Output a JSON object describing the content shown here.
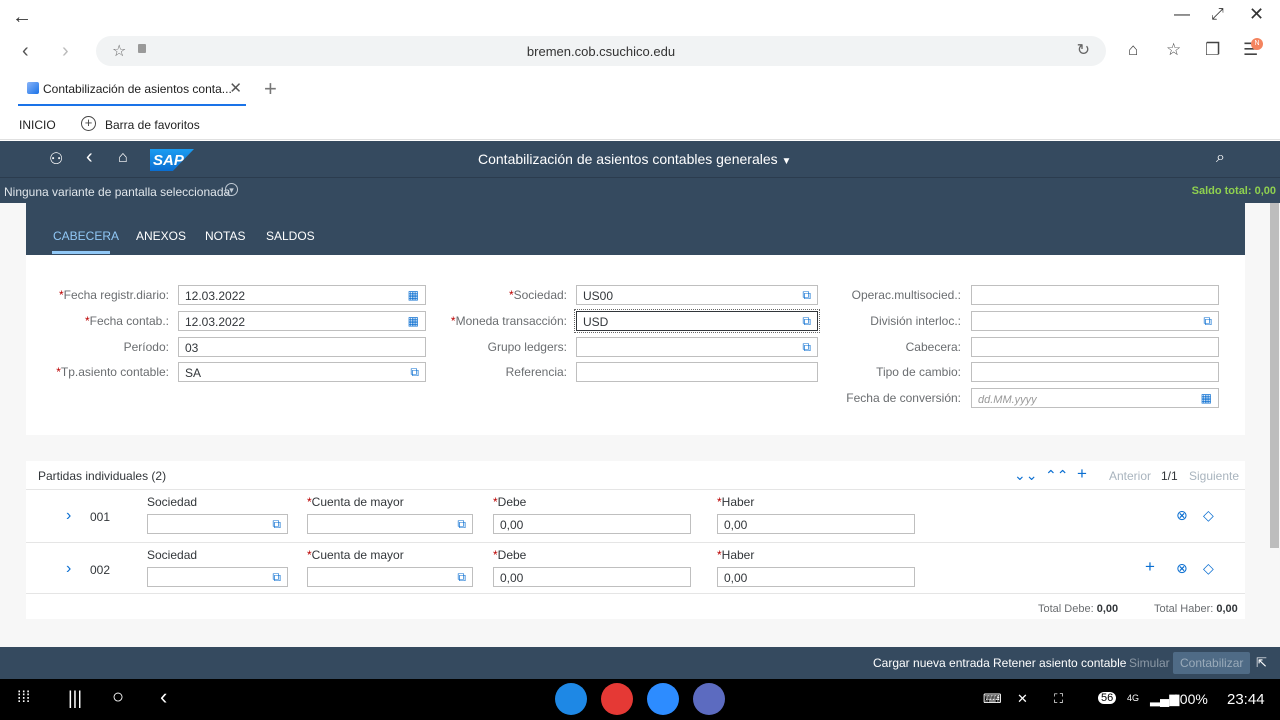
{
  "browser": {
    "url": "bremen.cob.csuchico.edu",
    "tab_title": "Contabilización de asientos conta...",
    "bookmarks": {
      "home": "INICIO",
      "favorites": "Barra de favoritos"
    },
    "profile_badge": "N"
  },
  "shell": {
    "app_title": "Contabilización de asientos contables generales",
    "logo_text": "SAP"
  },
  "subheader": {
    "variant": "Ninguna variante de pantalla seleccionada",
    "saldo_total": "Saldo total: 0,00"
  },
  "tabs": [
    {
      "label": "CABECERA",
      "selected": true
    },
    {
      "label": "ANEXOS"
    },
    {
      "label": "NOTAS"
    },
    {
      "label": "SALDOS"
    }
  ],
  "form": {
    "fecha_registr": {
      "label": "Fecha registr.diario:",
      "value": "12.03.2022"
    },
    "fecha_contab": {
      "label": "Fecha contab.:",
      "value": "12.03.2022"
    },
    "periodo": {
      "label": "Período:",
      "value": "03"
    },
    "tp_asiento": {
      "label": "Tp.asiento contable:",
      "value": "SA"
    },
    "sociedad": {
      "label": "Sociedad:",
      "value": "US00"
    },
    "moneda": {
      "label": "Moneda transacción:",
      "value": "USD"
    },
    "grupo_ledgers": {
      "label": "Grupo ledgers:",
      "value": ""
    },
    "referencia": {
      "label": "Referencia:",
      "value": ""
    },
    "operac_multi": {
      "label": "Operac.multisocied.:",
      "value": ""
    },
    "division": {
      "label": "División interloc.:",
      "value": ""
    },
    "cabecera": {
      "label": "Cabecera:",
      "value": ""
    },
    "tipo_cambio": {
      "label": "Tipo de cambio:",
      "value": ""
    },
    "fecha_conv": {
      "label": "Fecha de conversión:",
      "placeholder": "dd.MM.yyyy"
    }
  },
  "items": {
    "title": "Partidas individuales (2)",
    "prev": "Anterior",
    "page": "1/1",
    "next": "Siguiente",
    "col_sociedad": "Sociedad",
    "col_cuenta": "Cuenta de mayor",
    "col_debe": "Debe",
    "col_haber": "Haber",
    "rows": [
      {
        "num": "001",
        "debe": "0,00",
        "haber": "0,00"
      },
      {
        "num": "002",
        "debe": "0,00",
        "haber": "0,00"
      }
    ],
    "total_debe_label": "Total Debe:",
    "total_debe": "0,00",
    "total_haber_label": "Total Haber:",
    "total_haber": "0,00"
  },
  "footer": {
    "cargar": "Cargar nueva entrada",
    "retener": "Retener asiento contable",
    "simular": "Simular",
    "contabilizar": "Contabilizar"
  },
  "android": {
    "battery": "100%",
    "time": "23:44",
    "notif_count": "56",
    "network": "4G"
  }
}
